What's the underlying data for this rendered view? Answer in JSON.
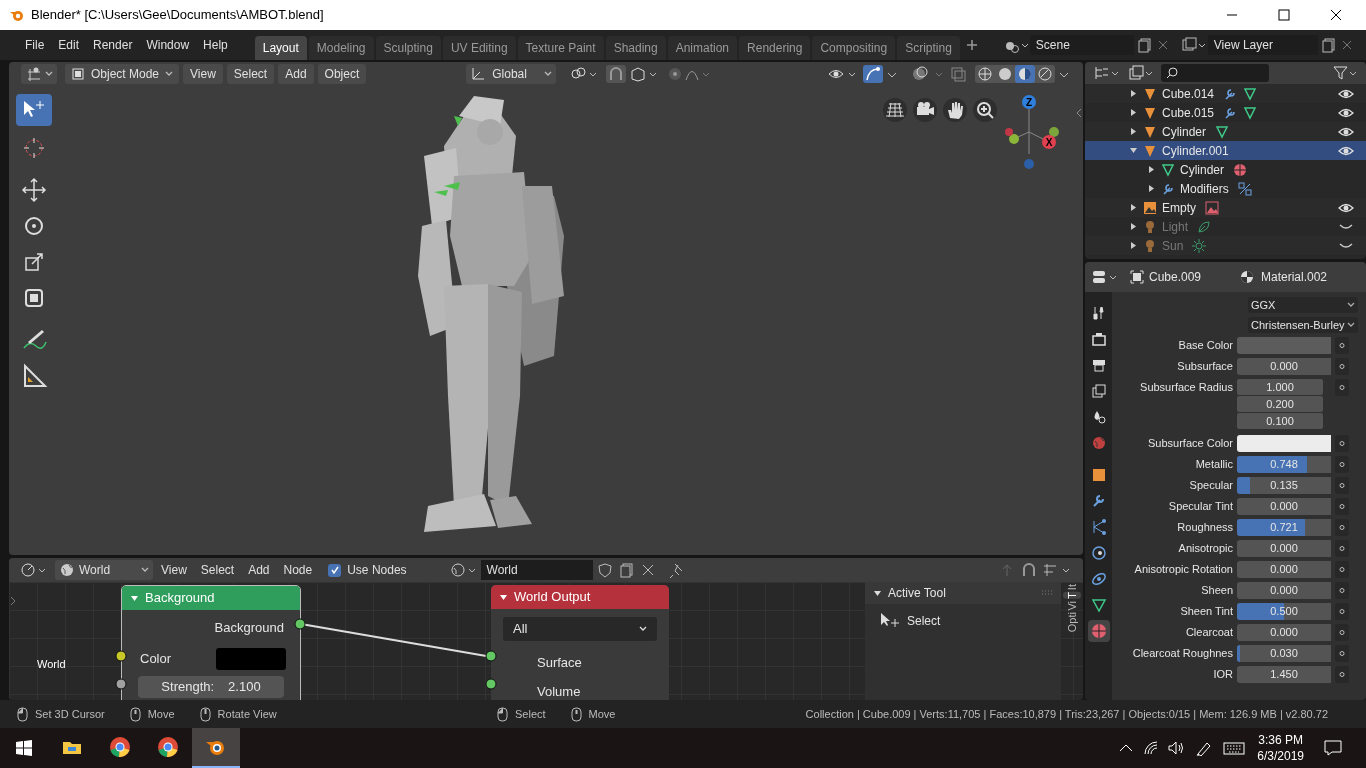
{
  "window": {
    "title": "Blender* [C:\\Users\\Gee\\Documents\\AMBOT.blend]"
  },
  "menus": [
    "File",
    "Edit",
    "Render",
    "Window",
    "Help"
  ],
  "workspaces": [
    {
      "label": "Layout",
      "selected": true
    },
    {
      "label": "Modeling",
      "selected": false
    },
    {
      "label": "Sculpting",
      "selected": false
    },
    {
      "label": "UV Editing",
      "selected": false
    },
    {
      "label": "Texture Paint",
      "selected": false
    },
    {
      "label": "Shading",
      "selected": false
    },
    {
      "label": "Animation",
      "selected": false
    },
    {
      "label": "Rendering",
      "selected": false
    },
    {
      "label": "Compositing",
      "selected": false
    },
    {
      "label": "Scripting",
      "selected": false
    }
  ],
  "scene": "Scene",
  "view_layer": "View Layer",
  "viewport": {
    "mode": "Object Mode",
    "menus": [
      "View",
      "Select",
      "Add",
      "Object"
    ],
    "orientation": "Global",
    "tools": [
      {
        "kind": "select",
        "selected": true
      },
      {
        "kind": "cursor",
        "selected": false
      },
      {
        "kind": "move",
        "selected": false
      },
      {
        "kind": "rotate",
        "selected": false
      },
      {
        "kind": "scale",
        "selected": false
      },
      {
        "kind": "transform",
        "selected": false
      },
      {
        "kind": "annotate",
        "selected": false
      },
      {
        "kind": "measure",
        "selected": false
      }
    ],
    "shading": [
      {
        "kind": "wireframe",
        "selected": false
      },
      {
        "kind": "solid",
        "selected": false
      },
      {
        "kind": "material",
        "selected": true
      },
      {
        "kind": "rendered",
        "selected": false
      }
    ],
    "axes": [
      {
        "label": "Z",
        "color": "#2f7fdc"
      },
      {
        "label": "X",
        "color": "#e0404f"
      }
    ]
  },
  "outliner": {
    "items": [
      {
        "name": "Cube.014",
        "kind": "mesh",
        "selected": false,
        "visible": true,
        "expanded": false,
        "modifiers": true
      },
      {
        "name": "Cube.015",
        "kind": "mesh",
        "selected": false,
        "visible": true,
        "expanded": false,
        "modifiers": true
      },
      {
        "name": "Cylinder",
        "kind": "mesh",
        "selected": false,
        "visible": true,
        "expanded": false
      },
      {
        "name": "Cylinder.001",
        "kind": "mesh",
        "selected": true,
        "visible": true,
        "expanded": true,
        "children": [
          {
            "name": "Cylinder",
            "kind": "meshdata",
            "expanded": false
          },
          {
            "name": "Modifiers",
            "kind": "modifier",
            "expanded": false
          }
        ]
      },
      {
        "name": "Empty",
        "kind": "empty",
        "selected": false,
        "visible": true,
        "expanded": false
      },
      {
        "name": "Light",
        "kind": "light",
        "selected": false,
        "visible": false,
        "expanded": false
      },
      {
        "name": "Sun",
        "kind": "sun",
        "selected": false,
        "visible": false,
        "expanded": false
      }
    ]
  },
  "properties": {
    "object": "Cube.009",
    "material": "Material.002",
    "tabs": [
      {
        "kind": "tool",
        "selected": false
      },
      {
        "kind": "render",
        "selected": false
      },
      {
        "kind": "output",
        "selected": false
      },
      {
        "kind": "viewlayer",
        "selected": false
      },
      {
        "kind": "scene",
        "selected": false
      },
      {
        "kind": "world",
        "selected": false
      },
      {
        "kind": "object",
        "selected": false
      },
      {
        "kind": "modifier",
        "selected": false
      },
      {
        "kind": "particles",
        "selected": false
      },
      {
        "kind": "physics",
        "selected": false
      },
      {
        "kind": "constraints",
        "selected": false
      },
      {
        "kind": "data",
        "selected": false
      },
      {
        "kind": "material",
        "selected": true
      }
    ],
    "dropdowns": [
      "GGX",
      "Christensen-Burley"
    ],
    "fields": [
      {
        "label": "Base Color",
        "kind": "color",
        "color": "#5c5c5c"
      },
      {
        "label": "Subsurface",
        "kind": "value",
        "value": "0.000",
        "level": 0
      },
      {
        "label": "Subsurface Radius",
        "kind": "vector",
        "values": [
          "1.000",
          "0.200",
          "0.100"
        ]
      },
      {
        "label": "Subsurface Color",
        "kind": "color",
        "color": "#ececec"
      },
      {
        "label": "Metallic",
        "kind": "value",
        "value": "0.748",
        "level": 0.748
      },
      {
        "label": "Specular",
        "kind": "value",
        "value": "0.135",
        "level": 0.135
      },
      {
        "label": "Specular Tint",
        "kind": "value",
        "value": "0.000",
        "level": 0
      },
      {
        "label": "Roughness",
        "kind": "value",
        "value": "0.721",
        "level": 0.721
      },
      {
        "label": "Anisotropic",
        "kind": "value",
        "value": "0.000",
        "level": 0
      },
      {
        "label": "Anisotropic Rotation",
        "kind": "value",
        "value": "0.000",
        "level": 0
      },
      {
        "label": "Sheen",
        "kind": "value",
        "value": "0.000",
        "level": 0
      },
      {
        "label": "Sheen Tint",
        "kind": "value",
        "value": "0.500",
        "level": 0.5
      },
      {
        "label": "Clearcoat",
        "kind": "value",
        "value": "0.000",
        "level": 0
      },
      {
        "label": "Clearcoat Roughnes",
        "kind": "value",
        "value": "0.030",
        "level": 0.03
      },
      {
        "label": "IOR",
        "kind": "value",
        "value": "1.450",
        "level": 0
      }
    ]
  },
  "node_editor": {
    "world_menu": "World",
    "menus": [
      "View",
      "Select",
      "Add",
      "Node"
    ],
    "use_nodes": {
      "label": "Use Nodes",
      "checked": true
    },
    "world_name": "World",
    "context_label": "World",
    "background_node": {
      "title": "Background",
      "output": "Background",
      "color_label": "Color",
      "color": "#000000",
      "strength_label": "Strength:",
      "strength": "2.100"
    },
    "output_node": {
      "title": "World Output",
      "target": "All",
      "inputs": [
        "Surface",
        "Volume"
      ]
    },
    "sidebar": {
      "panel": "Active Tool",
      "tool": "Select",
      "tabs": [
        {
          "label": "It",
          "selected": false
        },
        {
          "label": "T",
          "selected": true
        },
        {
          "label": "Vi",
          "selected": false
        },
        {
          "label": "Opti",
          "selected": false
        }
      ]
    }
  },
  "status_bar": {
    "hint_groups": [
      {
        "hints": [
          {
            "kind": "left",
            "label": "Set 3D Cursor"
          },
          {
            "kind": "middle",
            "label": "Move"
          },
          {
            "kind": "wheel",
            "label": "Rotate View"
          }
        ]
      },
      {
        "hints": [
          {
            "kind": "left",
            "label": "Select"
          },
          {
            "kind": "middle",
            "label": "Move"
          }
        ]
      }
    ],
    "stats": "Collection | Cube.009 | Verts:11,705 | Faces:10,879 | Tris:23,267 | Objects:0/15 | Mem: 126.9 MB | v2.80.72"
  },
  "taskbar": {
    "apps": [
      {
        "kind": "explorer",
        "selected": false
      },
      {
        "kind": "chrome",
        "selected": false
      },
      {
        "kind": "chrome",
        "selected": false
      },
      {
        "kind": "blender",
        "selected": true
      }
    ],
    "time": "3:36 PM",
    "date": "6/3/2019"
  }
}
